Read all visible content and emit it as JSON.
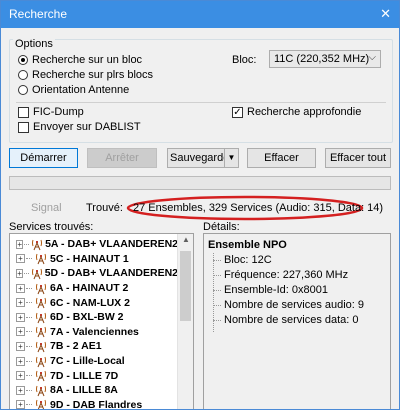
{
  "window": {
    "title": "Recherche",
    "close_glyph": "✕"
  },
  "options": {
    "label": "Options",
    "radios": [
      {
        "label": "Recherche sur un bloc",
        "checked": true
      },
      {
        "label": "Recherche sur plrs blocs",
        "checked": false
      },
      {
        "label": "Orientation Antenne",
        "checked": false
      }
    ],
    "bloc_label": "Bloc:",
    "bloc_value": "11C (220,352 MHz)",
    "fic_dump": {
      "label": "FIC-Dump",
      "checked": false
    },
    "dablist": {
      "label": "Envoyer sur DABLIST",
      "checked": false
    },
    "recherche_approfondie": {
      "label": "Recherche approfondie",
      "checked": true,
      "check_glyph": "✓"
    }
  },
  "buttons": {
    "demarrer": "Démarrer",
    "arreter": "Arrêter",
    "sauvegarder": "Sauvegarder",
    "sauvegarder_arrow": "▼",
    "effacer": "Effacer",
    "effacer_tout": "Effacer tout"
  },
  "status": {
    "signal_label": "Signal",
    "trouve_label": "Trouvé:",
    "trouve_value": "27 Ensembles, 329 Services (Audio: 315, Data: 14)",
    "highlight_color": "#d42020"
  },
  "services": {
    "label": "Services trouvés:",
    "items": [
      "5A - DAB+ VLAANDEREN2",
      "5C - HAINAUT 1",
      "5D - DAB+ VLAANDEREN2",
      "6A - HAINAUT 2",
      "6C - NAM-LUX 2",
      "6D - BXL-BW 2",
      "7A - Valenciennes",
      "7B - 2 AE1",
      "7C - Lille-Local",
      "7D - LILLE 7D",
      "8A - LILLE 8A",
      "9D - DAB Flandres"
    ],
    "expand_glyph": "+",
    "scroll_up_glyph": "▲"
  },
  "details": {
    "label": "Détails:",
    "title": "Ensemble NPO",
    "items": [
      "Bloc: 12C",
      "Fréquence: 227,360 MHz",
      "Ensemble-Id: 0x8001",
      "Nombre de services audio: 9",
      "Nombre de services data: 0"
    ]
  },
  "colors": {
    "titlebar": "#3b8ee3",
    "accent_border": "#0078d7"
  },
  "icons": {
    "tree_node": "antenna-icon"
  }
}
